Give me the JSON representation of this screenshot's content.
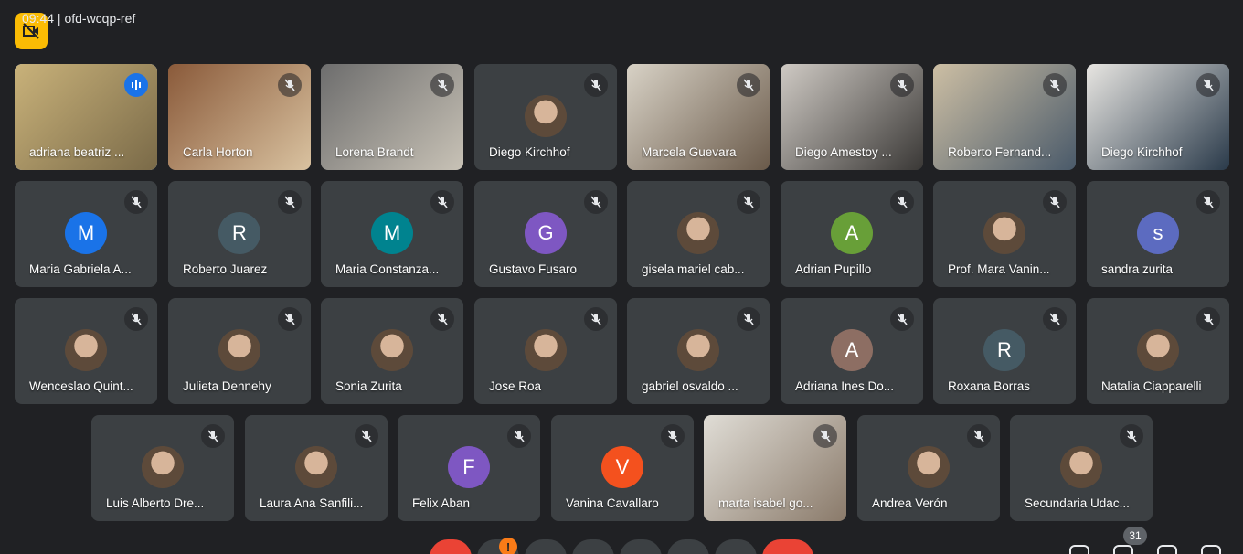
{
  "meeting": {
    "clock_text": "09:44  |  ofd-wcqp-ref",
    "participant_count": "31",
    "alert_badge": "!"
  },
  "colors": {
    "tile_bg": "#3c4043",
    "active_outline": "#8ab4f8",
    "end_call": "#ea4335",
    "badge_yellow": "#fbbc04"
  },
  "participants": [
    {
      "name": "adriana beatriz ...",
      "type": "video",
      "speaking": true
    },
    {
      "name": "Carla Horton",
      "type": "video"
    },
    {
      "name": "Lorena Brandt",
      "type": "video"
    },
    {
      "name": "Diego Kirchhof",
      "type": "photo"
    },
    {
      "name": "Marcela Guevara",
      "type": "video"
    },
    {
      "name": "Diego Amestoy ...",
      "type": "video"
    },
    {
      "name": "Roberto Fernand...",
      "type": "video"
    },
    {
      "name": "Diego Kirchhof",
      "type": "video"
    },
    {
      "name": "Maria Gabriela A...",
      "initial": "M",
      "color": "#1a73e8"
    },
    {
      "name": "Roberto Juarez",
      "initial": "R",
      "color": "#455a64"
    },
    {
      "name": "Maria Constanza...",
      "initial": "M",
      "color": "#00838f"
    },
    {
      "name": "Gustavo Fusaro",
      "initial": "G",
      "color": "#7e57c2"
    },
    {
      "name": "gisela mariel cab...",
      "type": "photo"
    },
    {
      "name": "Adrian Pupillo",
      "initial": "A",
      "color": "#689f38"
    },
    {
      "name": "Prof. Mara Vanin...",
      "type": "photo"
    },
    {
      "name": "sandra zurita",
      "initial": "s",
      "color": "#5c6bc0"
    },
    {
      "name": "Wenceslao Quint...",
      "type": "photo"
    },
    {
      "name": "Julieta Dennehy",
      "type": "photo"
    },
    {
      "name": "Sonia Zurita",
      "type": "photo"
    },
    {
      "name": "Jose Roa",
      "type": "photo"
    },
    {
      "name": "gabriel osvaldo ...",
      "type": "photo"
    },
    {
      "name": "Adriana Ines Do...",
      "initial": "A",
      "color": "#8d6e63"
    },
    {
      "name": "Roxana Borras",
      "initial": "R",
      "color": "#455a64"
    },
    {
      "name": "Natalia Ciapparelli",
      "type": "photo"
    },
    {
      "name": "Luis Alberto Dre...",
      "type": "photo"
    },
    {
      "name": "Laura Ana Sanfili...",
      "type": "photo"
    },
    {
      "name": "Felix Aban",
      "initial": "F",
      "color": "#7e57c2"
    },
    {
      "name": "Vanina Cavallaro",
      "initial": "V",
      "color": "#f4511e"
    },
    {
      "name": "marta isabel go...",
      "type": "video"
    },
    {
      "name": "Andrea Verón",
      "type": "photo"
    },
    {
      "name": "Secundaria Udac...",
      "type": "photo"
    }
  ]
}
